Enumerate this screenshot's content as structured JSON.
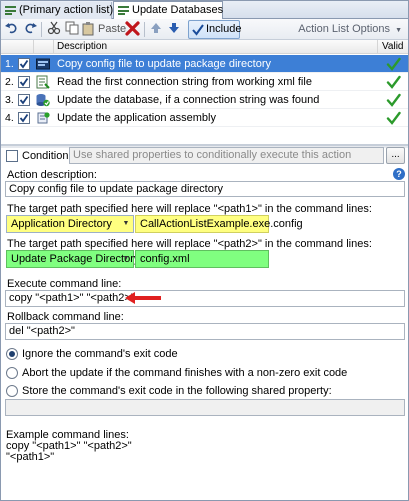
{
  "tabs": [
    {
      "label": "(Primary action list)"
    },
    {
      "label": "Update Databases"
    }
  ],
  "toolbar": {
    "paste_label": "Paste",
    "include_label": "Include",
    "options_label": "Action List Options"
  },
  "grid": {
    "columns": [
      "Description",
      "Valid"
    ],
    "rows": [
      {
        "num": "1.",
        "description": "Copy config file to update package directory",
        "icon": "copy-command-icon",
        "checked": true,
        "valid": true,
        "selected": true
      },
      {
        "num": "2.",
        "description": "Read the first connection string from working xml file",
        "icon": "read-xml-icon",
        "checked": true,
        "valid": true,
        "selected": false
      },
      {
        "num": "3.",
        "description": "Update the database, if a connection string was found",
        "icon": "update-database-icon",
        "checked": true,
        "valid": true,
        "selected": false
      },
      {
        "num": "4.",
        "description": "Update the application assembly",
        "icon": "update-assembly-icon",
        "checked": true,
        "valid": true,
        "selected": false
      }
    ]
  },
  "properties": {
    "condition_label": "Condition:",
    "condition_placeholder": "Use shared properties to conditionally execute this action",
    "ellipsis_label": "...",
    "action_description_label": "Action description:",
    "action_description_value": "Copy config file to update package directory",
    "path1_hint": "The target path specified here will replace \"<path1>\" in the command lines:",
    "path1_combo": "Application Directory",
    "path1_value": "CallActionListExample.exe.config",
    "path2_hint": "The target path specified here will replace \"<path2>\" in the command lines:",
    "path2_combo": "Update Package Directory",
    "path2_value": "config.xml",
    "execute_label": "Execute command line:",
    "execute_value": "copy \"<path1>\" \"<path2>\"",
    "rollback_label": "Rollback command line:",
    "rollback_value": "del \"<path2>\"",
    "radio_ignore": "Ignore the command's exit code",
    "radio_abort": "Abort the update if the command finishes with a non-zero exit code",
    "radio_store": "Store the command's exit code in the following shared property:",
    "example_title": "Example command lines:",
    "example_line1": "copy \"<path1>\" \"<path2>\"",
    "example_line2": "\"<path1>\""
  },
  "colors": {
    "path1_highlight": "#ffff80",
    "path2_highlight": "#80ff80",
    "selected_row": "#3d7fd6",
    "arrow": "#e02020"
  }
}
